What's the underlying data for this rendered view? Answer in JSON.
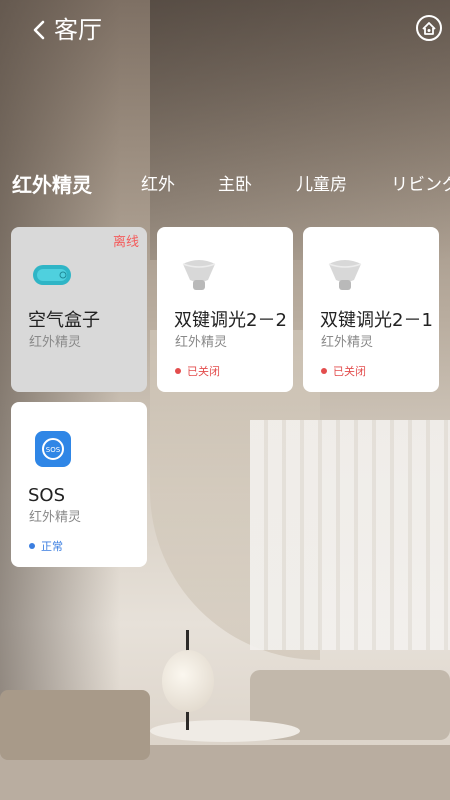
{
  "header": {
    "title": "客厅",
    "home_icon": "home-icon"
  },
  "tabs": [
    {
      "label": "红外精灵",
      "active": true
    },
    {
      "label": "红外",
      "active": false
    },
    {
      "label": "主卧",
      "active": false
    },
    {
      "label": "儿童房",
      "active": false
    },
    {
      "label": "リビング",
      "active": false
    }
  ],
  "devices": [
    {
      "name": "空气盒子",
      "sub": "红外精灵",
      "badge": "离线",
      "icon": "air-box-icon"
    },
    {
      "name": "双键调光2－2",
      "sub": "红外精灵",
      "status": "已关闭",
      "status_color": "#e34d4d",
      "icon": "light-bulb-icon"
    },
    {
      "name": "双键调光2－1",
      "sub": "红外精灵",
      "status": "已关闭",
      "status_color": "#e34d4d",
      "icon": "light-bulb-icon"
    },
    {
      "name": "SOS",
      "sub": "红外精灵",
      "status": "正常",
      "status_color": "#3b7ee0",
      "icon": "sos-icon",
      "icon_text": "SOS"
    }
  ],
  "colors": {
    "offline_badge": "#f45b5b",
    "card_bg": "#ffffff",
    "offline_card_bg": "#d9d9d9",
    "sos_blue": "#2f86e6",
    "air_box_teal": "#2fb5c6"
  }
}
